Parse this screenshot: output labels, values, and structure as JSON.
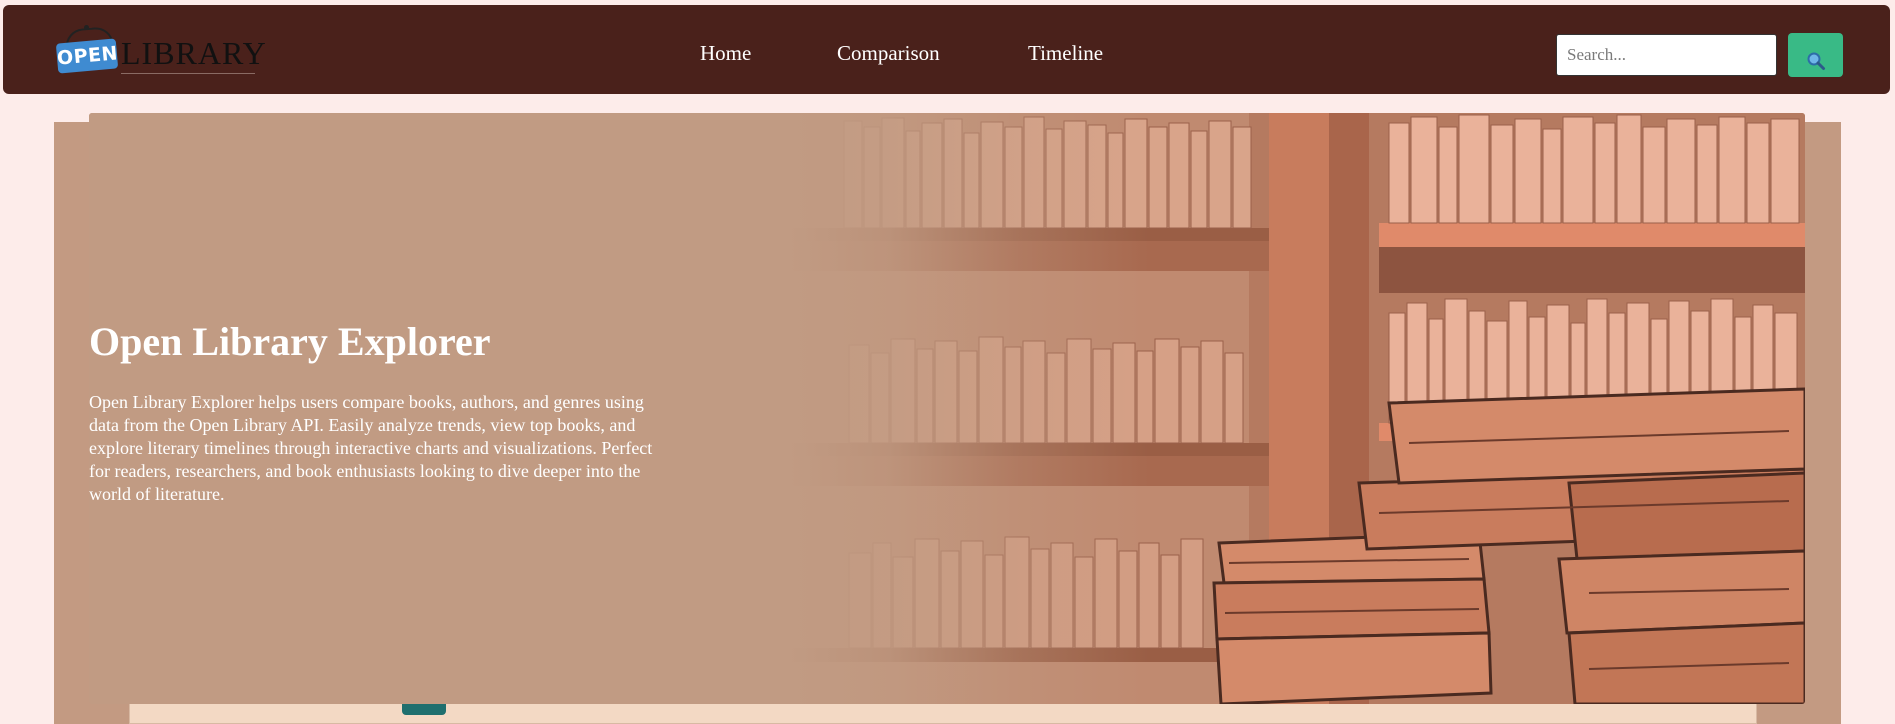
{
  "header": {
    "logo": {
      "badge": "OPEN",
      "word": "LIBRARY"
    },
    "nav": [
      {
        "label": "Home"
      },
      {
        "label": "Comparison"
      },
      {
        "label": "Timeline"
      }
    ],
    "search": {
      "value": "",
      "placeholder": "Search...",
      "button_icon": "search-icon"
    }
  },
  "hero": {
    "title": "Open Library Explorer",
    "description": "Open Library Explorer helps users compare books, authors, and genres using data from the Open Library API. Easily analyze trends, view top books, and explore literary timelines through interactive charts and visualizations. Perfect for readers, researchers, and book enthusiasts looking to dive deeper into the world of literature.",
    "background_image": "bookshelf-illustration"
  },
  "colors": {
    "navbar": "#4a211b",
    "page_background": "#fdecea",
    "hero_background": "#c19b83",
    "search_button": "#39ba86"
  }
}
